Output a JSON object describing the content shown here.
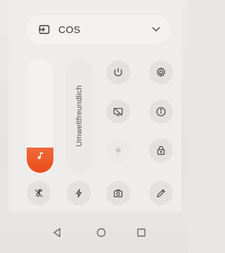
{
  "input_source": {
    "label": "COS",
    "icon": "input-source-icon",
    "chevron": "chevron-down-icon"
  },
  "volume": {
    "level": 0.22,
    "icon": "music-note-icon",
    "mute_icon": "music-off-icon"
  },
  "mode": {
    "label": "Umweltfreundlich",
    "icon": "bolt-icon"
  },
  "quick_tiles": [
    {
      "name": "power",
      "icon": "power-icon"
    },
    {
      "name": "settings",
      "icon": "gear-icon"
    },
    {
      "name": "screen-off",
      "icon": "screen-off-icon"
    },
    {
      "name": "info",
      "icon": "info-icon"
    },
    {
      "name": "bluetooth",
      "icon": "asterisk-icon"
    },
    {
      "name": "lock",
      "icon": "lock-icon"
    },
    {
      "name": "screenshot",
      "icon": "camera-icon"
    },
    {
      "name": "edit",
      "icon": "pencil-icon"
    }
  ],
  "nav": {
    "back_icon": "back-triangle-icon",
    "home_icon": "home-circle-icon",
    "recents_icon": "recents-square-icon"
  },
  "colors": {
    "accent": "#ea4b1a",
    "background": "#ebe9e7"
  }
}
